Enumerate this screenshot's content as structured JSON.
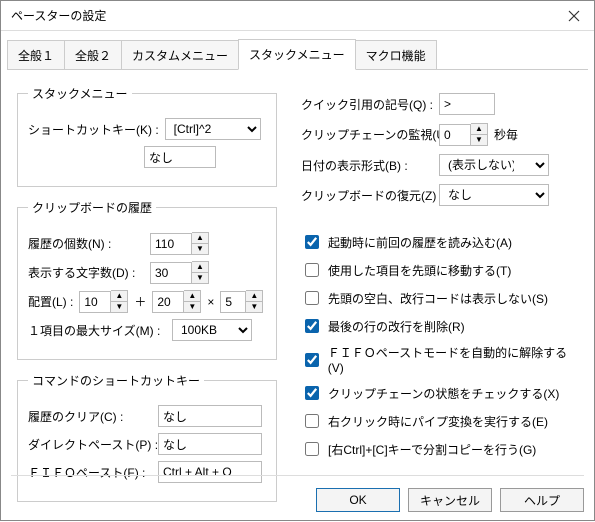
{
  "title": "ペースターの設定",
  "tabs": [
    "全般１",
    "全般２",
    "カスタムメニュー",
    "スタックメニュー",
    "マクロ機能"
  ],
  "activeTab": 3,
  "stackMenu": {
    "legend": "スタックメニュー",
    "shortcutLabel": "ショートカットキー(K) :",
    "shortcutValue": "[Ctrl]^2",
    "noneValue": "なし"
  },
  "history": {
    "legend": "クリップボードの履歴",
    "countLabel": "履歴の個数(N) :",
    "countValue": "110",
    "dispLabel": "表示する文字数(D) :",
    "dispValue": "30",
    "arrangeLabel": "配置(L) :",
    "arrangeA": "10",
    "arrangeB": "20",
    "arrangeC": "5",
    "plus": "＋",
    "times": "×",
    "maxSizeLabel": "１項目の最大サイズ(M) :",
    "maxSizeValue": "100KB"
  },
  "commandShortcut": {
    "legend": "コマンドのショートカットキー",
    "clearLabel": "履歴のクリア(C) :",
    "clearValue": "なし",
    "directLabel": "ダイレクトペースト(P) :",
    "directValue": "なし",
    "fifoLabel": "ＦＩＦＯペースト(F) :",
    "fifoValue": "Ctrl + Alt + O"
  },
  "right": {
    "quickQuoteLabel": "クイック引用の記号(Q) :",
    "quickQuoteValue": ">",
    "chainWatchLabel": "クリップチェーンの監視(U) :",
    "chainWatchValue": "0",
    "secSuffix": "秒毎",
    "dateFormatLabel": "日付の表示形式(B) :",
    "dateFormatValue": "(表示しない)",
    "restoreLabel": "クリップボードの復元(Z) :",
    "restoreValue": "なし"
  },
  "checks": [
    {
      "checked": true,
      "label": "起動時に前回の履歴を読み込む(A)"
    },
    {
      "checked": false,
      "label": "使用した項目を先頭に移動する(T)"
    },
    {
      "checked": false,
      "label": "先頭の空白、改行コードは表示しない(S)"
    },
    {
      "checked": true,
      "label": "最後の行の改行を削除(R)"
    },
    {
      "checked": true,
      "label": "ＦＩＦＯペーストモードを自動的に解除する(V)"
    },
    {
      "checked": true,
      "label": "クリップチェーンの状態をチェックする(X)"
    },
    {
      "checked": false,
      "label": "右クリック時にパイプ変換を実行する(E)"
    },
    {
      "checked": false,
      "label": "[右Ctrl]+[C]キーで分割コピーを行う(G)"
    }
  ],
  "buttons": {
    "ok": "OK",
    "cancel": "キャンセル",
    "help": "ヘルプ"
  }
}
